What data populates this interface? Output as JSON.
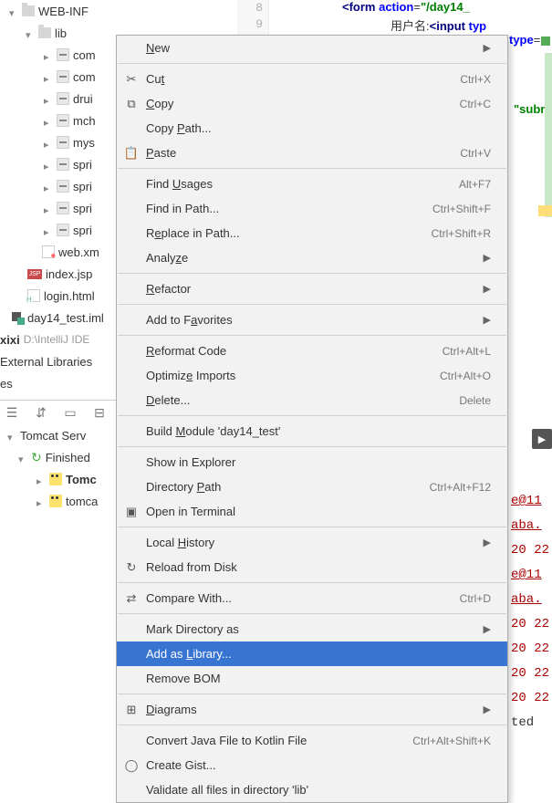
{
  "tree": {
    "web_inf": "WEB-INF",
    "lib": "lib",
    "items": [
      "com",
      "com",
      "drui",
      "mch",
      "mys",
      "spri",
      "spri",
      "spri",
      "spri"
    ],
    "web_xml": "web.xm",
    "index_jsp": "index.jsp",
    "login_html": "login.html",
    "iml": "day14_test.iml",
    "xixi": "xixi",
    "xixi_path": "D:\\IntelliJ IDE",
    "ext_lib": "External Libraries",
    "es": "es"
  },
  "gutter": {
    "l8": "8",
    "l9": "9"
  },
  "code": {
    "line1a": "<",
    "line1b": "form ",
    "line1c": "action",
    "line1d": "=",
    "line1e": "\"/day14_",
    "line2a": "用户名:",
    "line2b": "<",
    "line2c": "input ",
    "line2d": "typ",
    "line3a": "type",
    "line3b": "=",
    "line4": "\"subm"
  },
  "menu": [
    {
      "label": "New",
      "icon": "",
      "shortcut": "",
      "arrow": true,
      "ul": 0
    },
    {
      "sep": true
    },
    {
      "label": "Cut",
      "icon": "✂",
      "shortcut": "Ctrl+X",
      "ul": 2
    },
    {
      "label": "Copy",
      "icon": "⧉",
      "shortcut": "Ctrl+C",
      "ul": 0
    },
    {
      "label": "Copy Path...",
      "icon": "",
      "shortcut": "",
      "ul": 5
    },
    {
      "label": "Paste",
      "icon": "📋",
      "shortcut": "Ctrl+V",
      "ul": 0
    },
    {
      "sep": true
    },
    {
      "label": "Find Usages",
      "icon": "",
      "shortcut": "Alt+F7",
      "ul": 5
    },
    {
      "label": "Find in Path...",
      "icon": "",
      "shortcut": "Ctrl+Shift+F"
    },
    {
      "label": "Replace in Path...",
      "icon": "",
      "shortcut": "Ctrl+Shift+R",
      "ul": 1
    },
    {
      "label": "Analyze",
      "icon": "",
      "arrow": true,
      "ul": 5
    },
    {
      "sep": true
    },
    {
      "label": "Refactor",
      "icon": "",
      "arrow": true,
      "ul": 0
    },
    {
      "sep": true
    },
    {
      "label": "Add to Favorites",
      "icon": "",
      "arrow": true,
      "ul": 8
    },
    {
      "sep": true
    },
    {
      "label": "Reformat Code",
      "icon": "",
      "shortcut": "Ctrl+Alt+L",
      "ul": 0
    },
    {
      "label": "Optimize Imports",
      "icon": "",
      "shortcut": "Ctrl+Alt+O",
      "ul": 7
    },
    {
      "label": "Delete...",
      "icon": "",
      "shortcut": "Delete",
      "ul": 0
    },
    {
      "sep": true
    },
    {
      "label": "Build Module 'day14_test'",
      "icon": "",
      "ul": 6
    },
    {
      "sep": true
    },
    {
      "label": "Show in Explorer",
      "icon": ""
    },
    {
      "label": "Directory Path",
      "icon": "",
      "shortcut": "Ctrl+Alt+F12",
      "ul": 10
    },
    {
      "label": "Open in Terminal",
      "icon": "▣"
    },
    {
      "sep": true
    },
    {
      "label": "Local History",
      "icon": "",
      "arrow": true,
      "ul": 6
    },
    {
      "label": "Reload from Disk",
      "icon": "↻"
    },
    {
      "sep": true
    },
    {
      "label": "Compare With...",
      "icon": "⇄",
      "shortcut": "Ctrl+D"
    },
    {
      "sep": true
    },
    {
      "label": "Mark Directory as",
      "icon": "",
      "arrow": true
    },
    {
      "label": "Add as Library...",
      "icon": "",
      "highlighted": true,
      "ul": 7
    },
    {
      "label": "Remove BOM",
      "icon": ""
    },
    {
      "sep": true
    },
    {
      "label": "Diagrams",
      "icon": "⊞",
      "arrow": true,
      "ul": 0
    },
    {
      "sep": true
    },
    {
      "label": "Convert Java File to Kotlin File",
      "icon": "",
      "shortcut": "Ctrl+Alt+Shift+K"
    },
    {
      "label": "Create Gist...",
      "icon": "◯"
    },
    {
      "label": "Validate all files in directory 'lib'",
      "icon": ""
    }
  ],
  "bottom": {
    "es": "es",
    "tomcat": "Tomcat Serv",
    "finished": "Finished",
    "tomc_bold": "Tomc",
    "tomc": "tomca"
  },
  "console": {
    "l1": "e@11",
    "l2": "aba.",
    "l3": "20 22",
    "l4": "e@11",
    "l5": "aba.",
    "l6": "20 22",
    "l7": "20 22",
    "l8": "20 22",
    "l9": "20 22",
    "l10": "ted "
  }
}
